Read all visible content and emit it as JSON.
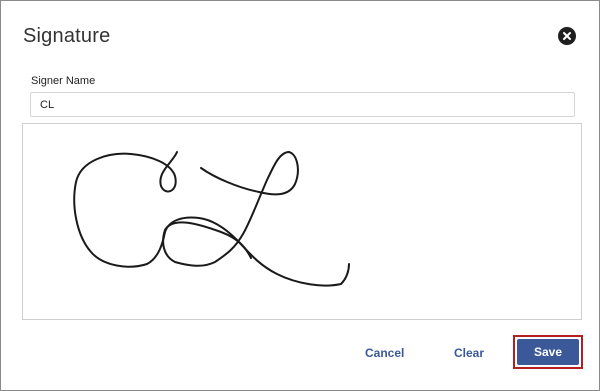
{
  "dialog": {
    "title": "Signature",
    "close_icon": "close-circle-icon"
  },
  "signer": {
    "label": "Signer Name",
    "value": "CL"
  },
  "signature_pad": {
    "stroke_color": "#1a1a1a"
  },
  "actions": {
    "cancel_label": "Cancel",
    "clear_label": "Clear",
    "save_label": "Save"
  },
  "colors": {
    "accent": "#3b5998",
    "focus_outline": "#b42020"
  }
}
